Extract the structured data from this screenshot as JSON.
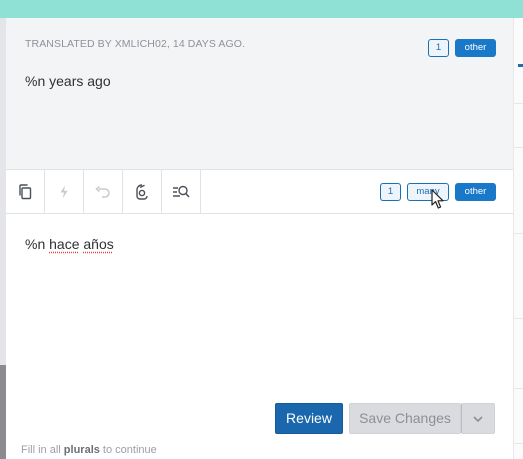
{
  "source": {
    "meta": "TRANSLATED BY XMLICH02, 14 DAYS AGO.",
    "text": "%n years ago",
    "plural_badges": [
      {
        "label": "1",
        "active": false
      },
      {
        "label": "other",
        "active": true
      }
    ]
  },
  "toolbar": {
    "tools": [
      {
        "icon": "copy-icon"
      },
      {
        "icon": "machine-translate-icon"
      },
      {
        "icon": "undo-icon"
      },
      {
        "icon": "glossary-icon"
      },
      {
        "icon": "search-concordance-icon"
      }
    ],
    "plural_tabs": [
      {
        "label": "1",
        "active": false
      },
      {
        "label": "many",
        "active": false
      },
      {
        "label": "other",
        "active": true
      }
    ]
  },
  "editor": {
    "text_prefix": "%n ",
    "misspelled_1": "hace",
    "text_middle": " ",
    "misspelled_2": "años"
  },
  "actions": {
    "review_label": "Review",
    "save_label": "Save Changes",
    "dropdown_icon": "chevron-down-icon"
  },
  "hint": {
    "before": "Fill in all ",
    "emphasis": "plurals",
    "after": " to continue"
  },
  "colors": {
    "accent_top": "#8fe1d6",
    "primary": "#1a67ad",
    "badge_active": "#1a78c9",
    "disabled": "#d9dbde"
  }
}
